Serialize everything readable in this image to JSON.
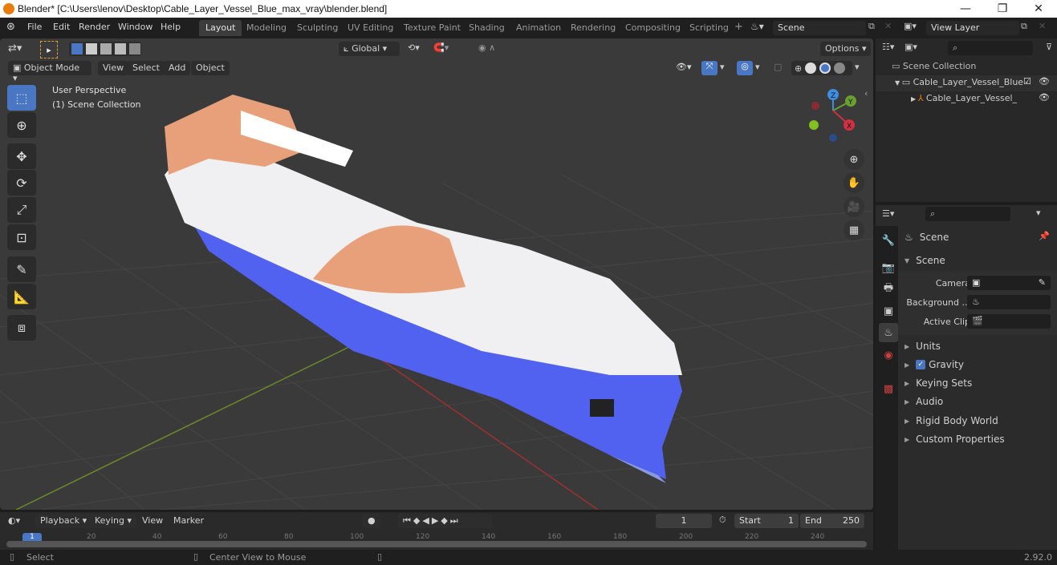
{
  "window": {
    "title": "Blender* [C:\\Users\\lenov\\Desktop\\Cable_Layer_Vessel_Blue_max_vray\\blender.blend]",
    "minimize": "—",
    "maximize": "❐",
    "close": "✕"
  },
  "menubar": {
    "items": [
      "File",
      "Edit",
      "Render",
      "Window",
      "Help"
    ]
  },
  "workspaces": {
    "tabs": [
      "Layout",
      "Modeling",
      "Sculpting",
      "UV Editing",
      "Texture Paint",
      "Shading",
      "Animation",
      "Rendering",
      "Compositing",
      "Scripting"
    ],
    "active": "Layout",
    "add": "+"
  },
  "scene_selector": {
    "value": "Scene"
  },
  "view_layer_selector": {
    "value": "View Layer"
  },
  "viewport_header": {
    "transform_orientation": "Global",
    "options_label": "Options",
    "mode": "Object Mode",
    "menus": [
      "View",
      "Select",
      "Add",
      "Object"
    ]
  },
  "viewport": {
    "perspective_label": "User Perspective",
    "collection_label": "(1) Scene Collection",
    "gizmo": {
      "z": "Z",
      "y": "Y",
      "x": "X"
    },
    "colors": {
      "hull_blue": "#5262f0",
      "crane_orange": "#e8a07a",
      "x_axis": "#d03040",
      "y_axis": "#6aa030"
    }
  },
  "outliner": {
    "search_placeholder": "",
    "root": "Scene Collection",
    "items": [
      {
        "label": "Cable_Layer_Vessel_Blue",
        "type": "collection",
        "checked": true,
        "visible": true
      },
      {
        "label": "Cable_Layer_Vessel_",
        "type": "object",
        "visible": true
      }
    ]
  },
  "properties": {
    "search_placeholder": "",
    "context": "Scene",
    "panel_title": "Scene",
    "fields": [
      {
        "label": "Camera",
        "value": ""
      },
      {
        "label": "Background ...",
        "value": ""
      },
      {
        "label": "Active Clip",
        "value": ""
      }
    ],
    "sections": [
      {
        "label": "Units"
      },
      {
        "label": "Gravity",
        "checked": true
      },
      {
        "label": "Keying Sets"
      },
      {
        "label": "Audio"
      },
      {
        "label": "Rigid Body World"
      },
      {
        "label": "Custom Properties"
      }
    ]
  },
  "timeline": {
    "menus": [
      "Playback",
      "Keying",
      "View",
      "Marker"
    ],
    "current_frame": "1",
    "start_label": "Start",
    "start": "1",
    "end_label": "End",
    "end": "250",
    "ruler": [
      "1",
      "20",
      "40",
      "60",
      "80",
      "100",
      "120",
      "140",
      "160",
      "180",
      "200",
      "220",
      "240"
    ]
  },
  "statusbar": {
    "left_action": "Select",
    "middle_action": "Center View to Mouse",
    "version": "2.92.0"
  }
}
